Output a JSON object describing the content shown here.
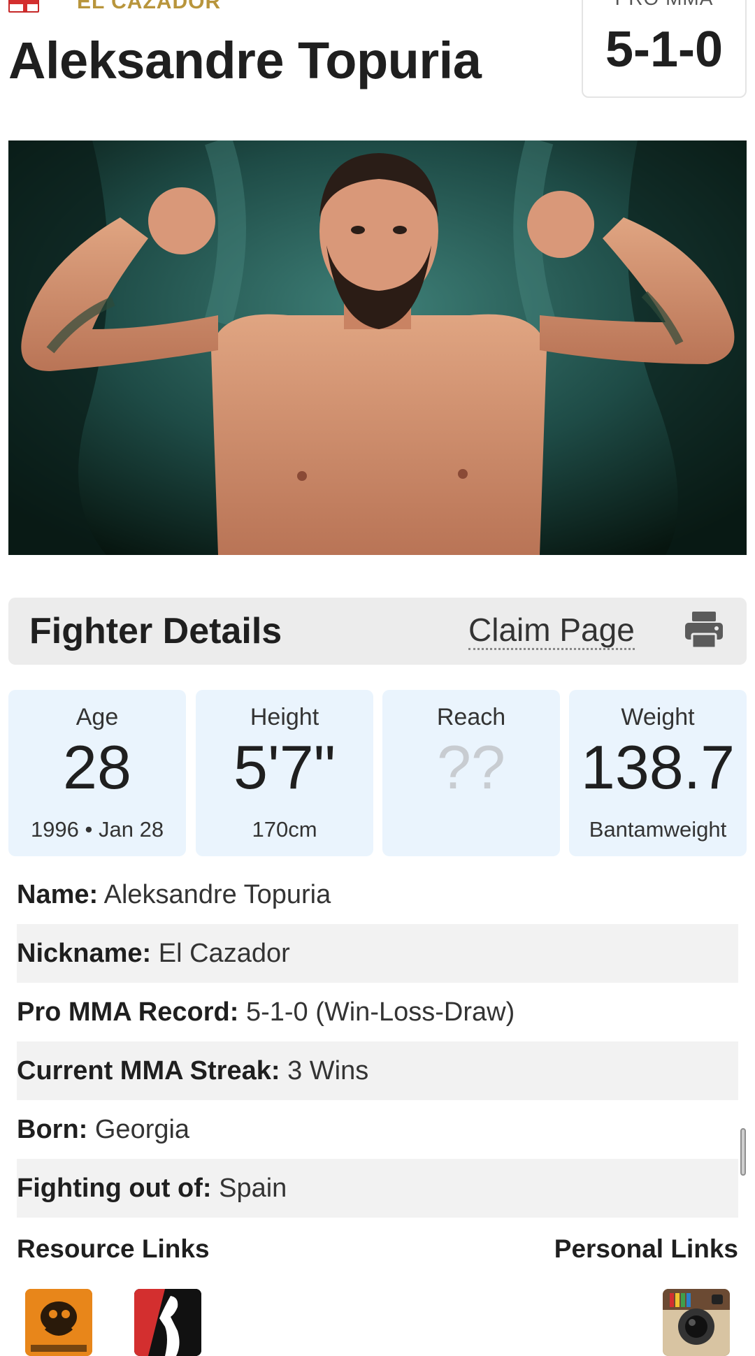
{
  "header": {
    "nickname_upper": "EL CAZADOR",
    "name": "Aleksandre Topuria",
    "record_label": "PRO MMA",
    "record_value": "5-1-0"
  },
  "details_bar": {
    "title": "Fighter Details",
    "claim_label": "Claim Page",
    "print_icon": "printer-icon"
  },
  "stats": {
    "age": {
      "label": "Age",
      "value": "28",
      "sub": "1996 • Jan 28"
    },
    "height": {
      "label": "Height",
      "value": "5'7\"",
      "sub": "170cm"
    },
    "reach": {
      "label": "Reach",
      "value": "??",
      "sub": ""
    },
    "weight": {
      "label": "Weight",
      "value": "138.7",
      "sub": "Bantamweight"
    }
  },
  "info": [
    {
      "key": "Name:",
      "value": "Aleksandre Topuria"
    },
    {
      "key": "Nickname:",
      "value": "El Cazador"
    },
    {
      "key": "Pro MMA Record:",
      "value": "5-1-0 (Win-Loss-Draw)"
    },
    {
      "key": "Current MMA Streak:",
      "value": "3 Wins"
    },
    {
      "key": "Born:",
      "value": "Georgia"
    },
    {
      "key": "Fighting out of:",
      "value": "Spain"
    }
  ],
  "links": {
    "resource_title": "Resource Links",
    "personal_title": "Personal Links",
    "resource_icons": [
      "sherdog-icon",
      "ufc-fighter-icon"
    ],
    "personal_icons": [
      "instagram-icon"
    ]
  },
  "colors": {
    "nickname_gold": "#b8953c",
    "stat_card_bg": "#eaf4fd",
    "details_bar_bg": "#ececec",
    "row_shade": "#f2f2f2"
  }
}
